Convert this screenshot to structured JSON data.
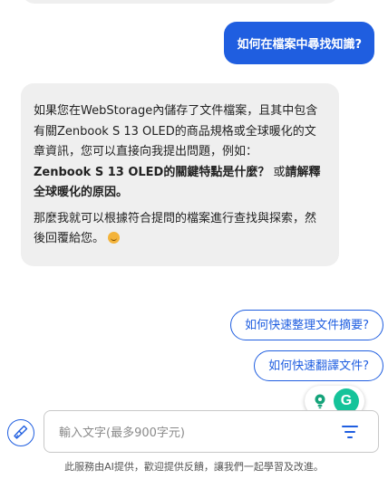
{
  "chat": {
    "user_question": "如何在檔案中尋找知識?",
    "bot_reply": {
      "p1_lead": "如果您在WebStorage內儲存了文件檔案，且其中包含有關Zenbook S 13 OLED的商品規格或全球暖化的文章資訊，您可以直接向我提出問題，例如：",
      "p1_example1": "Zenbook S 13 OLED的關鍵特點是什麼？",
      "p1_or": " 或",
      "p1_example2": "請解釋全球暖化的原因。",
      "p2": "那麼我就可以根據符合提問的檔案進行查找與探索，然後回覆給您。"
    }
  },
  "suggestions": [
    "如何快速整理文件摘要?",
    "如何快速翻譯文件?"
  ],
  "extensions": {
    "grammarly_letter": "G"
  },
  "composer": {
    "placeholder": "輸入文字(最多900字元)",
    "value": ""
  },
  "footer": {
    "disclaimer": "此服務由AI提供，歡迎提供反饋，讓我們一起學習及改進。"
  },
  "colors": {
    "accent": "#1f5ee0",
    "bubble_bg": "#efefef",
    "grammarly": "#15c39a"
  },
  "icons": {
    "clear": "broom-icon",
    "filter": "filter-icon",
    "emoji": "smile-emoji-icon",
    "lightbulb": "lightbulb-icon"
  }
}
